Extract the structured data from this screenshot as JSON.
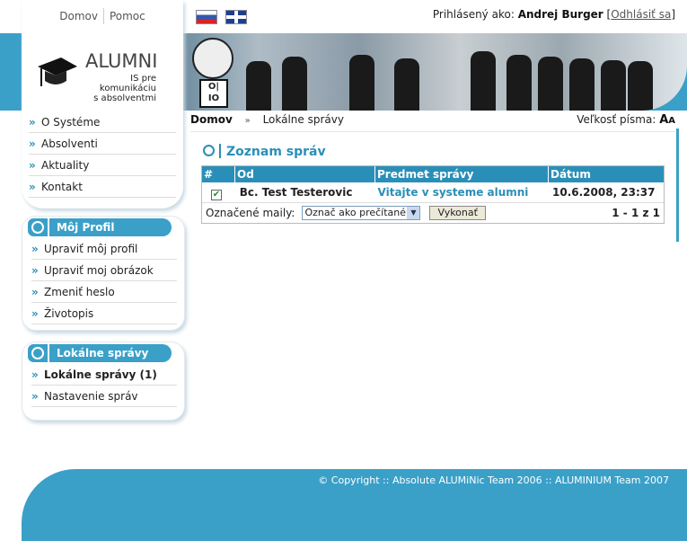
{
  "toplinks": {
    "home": "Domov",
    "help": "Pomoc"
  },
  "login": {
    "prefix": "Prihlásený ako:",
    "user": "Andrej Burger",
    "logout": "Odhlásiť sa"
  },
  "logo": {
    "title": "ALUMNI",
    "sub1": "IS pre komunikáciu",
    "sub2": "s absolventmi"
  },
  "menu": [
    "O Systéme",
    "Absolventi",
    "Aktuality",
    "Kontakt"
  ],
  "profile": {
    "title": "Môj Profil",
    "items": [
      "Upraviť môj profil",
      "Upraviť moj obrázok",
      "Zmeniť heslo",
      "Životopis"
    ]
  },
  "messages_panel": {
    "title": "Lokálne správy",
    "items": [
      "Lokálne správy (1)",
      "Nastavenie správ"
    ]
  },
  "breadcrumb": {
    "home": "Domov",
    "arrow": "»",
    "current": "Lokálne správy"
  },
  "font_size": {
    "label": "Veľkosť písma:",
    "large": "A",
    "small": "A"
  },
  "main": {
    "title": "Zoznam správ"
  },
  "table": {
    "headers": [
      "#",
      "Od",
      "Predmet správy",
      "Dátum"
    ],
    "rows": [
      {
        "from": "Bc. Test Testerovic",
        "subject": "Vitajte v systeme alumni",
        "date": "10.6.2008, 23:37",
        "checked": true
      }
    ],
    "marked_label": "Označené maily:",
    "action_value": "Označ ako prečítané",
    "submit": "Vykonať",
    "pagination": "1 - 1 z 1"
  },
  "footer": {
    "copyright": "© Copyright :: Absolute ALUMiNic Team 2006 :: ALUMINIUM Team 2007"
  },
  "colors": {
    "accent": "#3aa0c8"
  }
}
